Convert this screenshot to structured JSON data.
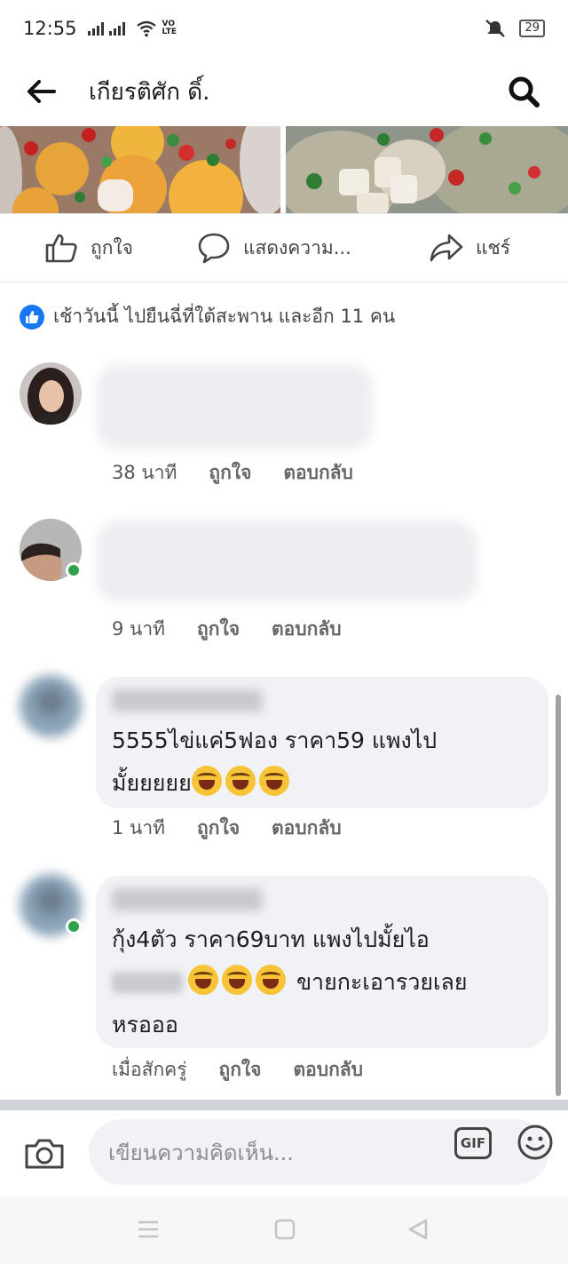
{
  "status_bar": {
    "time": "12:55",
    "volte": "VO LTE",
    "battery": "29"
  },
  "header": {
    "title": "เกียรติศัก ดิ์."
  },
  "actions": {
    "like": "ถูกใจ",
    "comment": "แสดงความ...",
    "share": "แชร์"
  },
  "likes_summary": "เช้าวันนี้ ไปยืนฉี่ที่ใต้สะพาน และอีก 11 คน",
  "comments": [
    {
      "time": "38 นาที",
      "like": "ถูกใจ",
      "reply": "ตอบกลับ"
    },
    {
      "time": "9 นาที",
      "like": "ถูกใจ",
      "reply": "ตอบกลับ"
    },
    {
      "text_line1": "5555ไข่แค่5ฟอง ราคา59 แพงไป",
      "text_line2": "มั้ยยยยย",
      "time": "1 นาที",
      "like": "ถูกใจ",
      "reply": "ตอบกลับ"
    },
    {
      "text_line1": "กุ้ง4ตัว ราคา69บาท แพงไปมั้ยไอ",
      "text_line2": "ขายกะเอารวยเลย",
      "text_line3": "หรอออ",
      "time": "เมื่อสักครู่",
      "like": "ถูกใจ",
      "reply": "ตอบกลับ"
    }
  ],
  "composer": {
    "placeholder": "เขียนความคิดเห็น...",
    "gif": "GIF"
  },
  "colors": {
    "accent": "#1877f2",
    "online": "#31a24c",
    "bubble": "#f0f2f5"
  }
}
